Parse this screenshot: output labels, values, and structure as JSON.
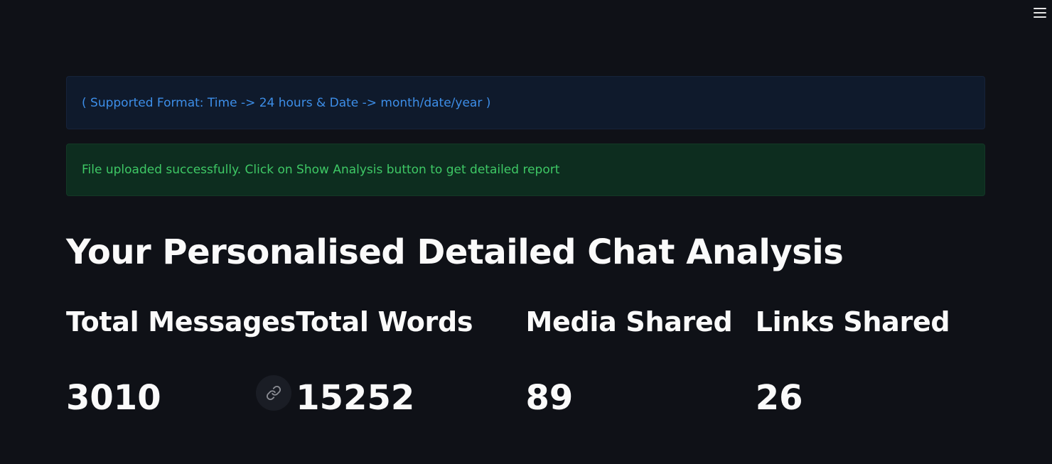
{
  "header": {
    "menu_icon": "hamburger-menu-icon"
  },
  "alerts": {
    "info": "( Supported Format: Time -> 24 hours & Date -> month/date/year )",
    "success": "File uploaded successfully. Click on Show Analysis button to get detailed report"
  },
  "page": {
    "title": "Your Personalised Detailed Chat Analysis"
  },
  "metrics": [
    {
      "label": "Total Messages",
      "value": "3010"
    },
    {
      "label": "Total Words",
      "value": "15252"
    },
    {
      "label": "Media Shared",
      "value": "89"
    },
    {
      "label": "Links Shared",
      "value": "26"
    }
  ],
  "anchor": {
    "icon": "link-icon"
  },
  "colors": {
    "background": "#0f1117",
    "info_text": "#3d8ee8",
    "info_bg": "#0f1a2c",
    "success_text": "#3ec865",
    "success_bg": "#0d2d1f",
    "text": "#fafafa"
  }
}
